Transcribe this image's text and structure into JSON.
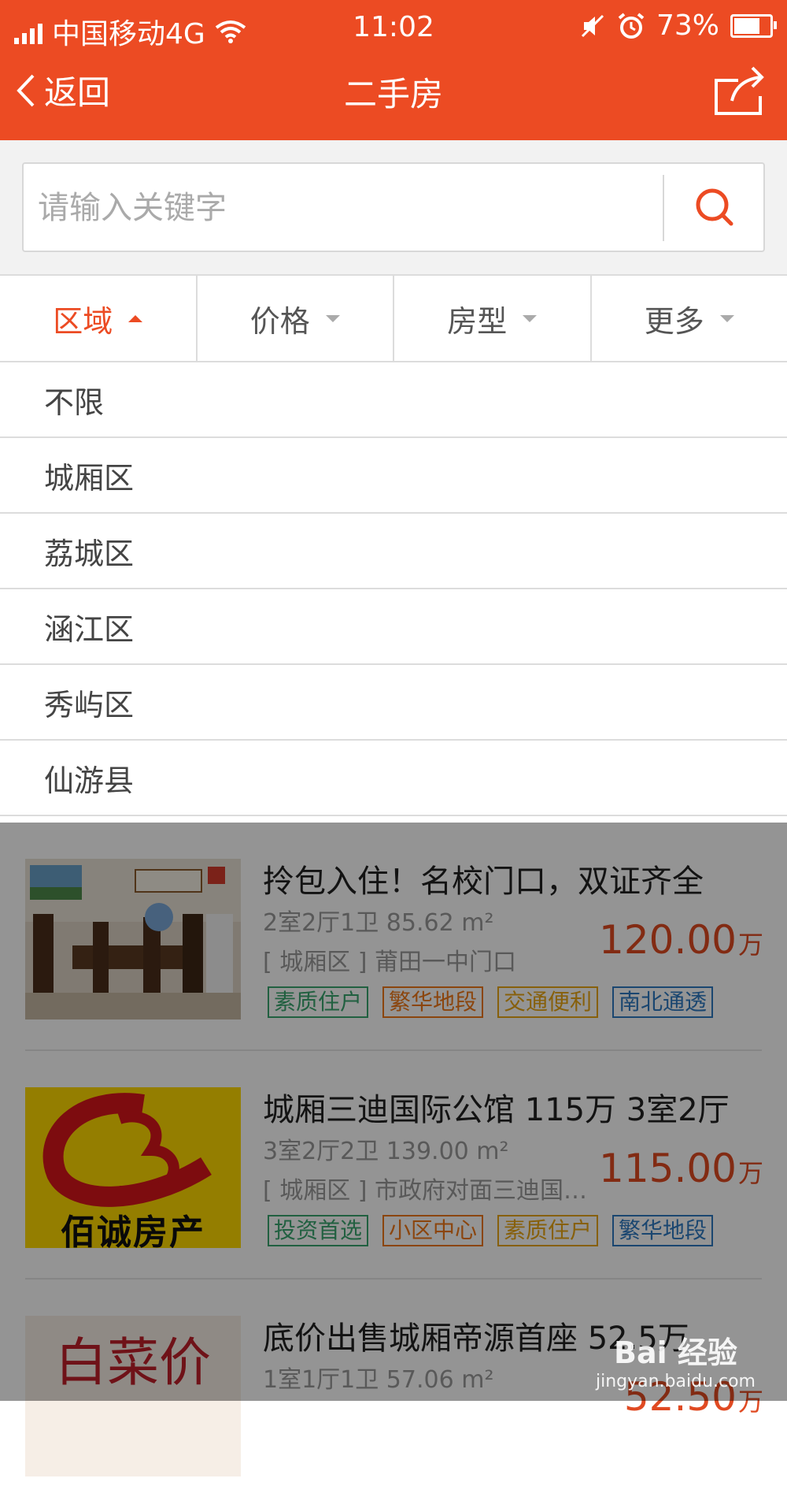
{
  "status_bar": {
    "carrier": "中国移动4G",
    "time": "11:02",
    "battery": "73%",
    "battery_level": 0.73
  },
  "nav": {
    "back_label": "返回",
    "title": "二手房"
  },
  "search": {
    "placeholder": "请输入关键字"
  },
  "filters": [
    {
      "label": "区域",
      "active": true
    },
    {
      "label": "价格",
      "active": false
    },
    {
      "label": "房型",
      "active": false
    },
    {
      "label": "更多",
      "active": false
    }
  ],
  "region_dropdown": [
    "不限",
    "城厢区",
    "荔城区",
    "涵江区",
    "秀屿区",
    "仙游县"
  ],
  "listings": [
    {
      "title": "拎包入住！名校门口，双证齐全",
      "spec": "2室2厅1卫 85.62 m²",
      "address": "[ 城厢区 ] 莆田一中门口",
      "price": "120.00",
      "price_unit": "万",
      "tags": [
        "素质住户",
        "繁华地段",
        "交通便利",
        "南北通透"
      ]
    },
    {
      "title": "城厢三迪国际公馆 115万 3室2厅",
      "spec": "3室2厅2卫 139.00 m²",
      "address": "[ 城厢区 ] 市政府对面三迪国际公馆",
      "price": "115.00",
      "price_unit": "万",
      "tags": [
        "投资首选",
        "小区中心",
        "素质住户",
        "繁华地段"
      ],
      "thumb_text": "佰诚房产"
    },
    {
      "title": "底价出售城厢帝源首座 52.5万",
      "spec": "1室1厅1卫 57.06 m²",
      "address": "",
      "price": "52.50",
      "price_unit": "万",
      "tags": [],
      "thumb_text": "白菜价"
    }
  ],
  "watermark": {
    "logo": "Bai 经验",
    "sub": "jingyan.baidu.com"
  },
  "colors": {
    "brand": "#ec4b23",
    "price": "#e04a22"
  }
}
